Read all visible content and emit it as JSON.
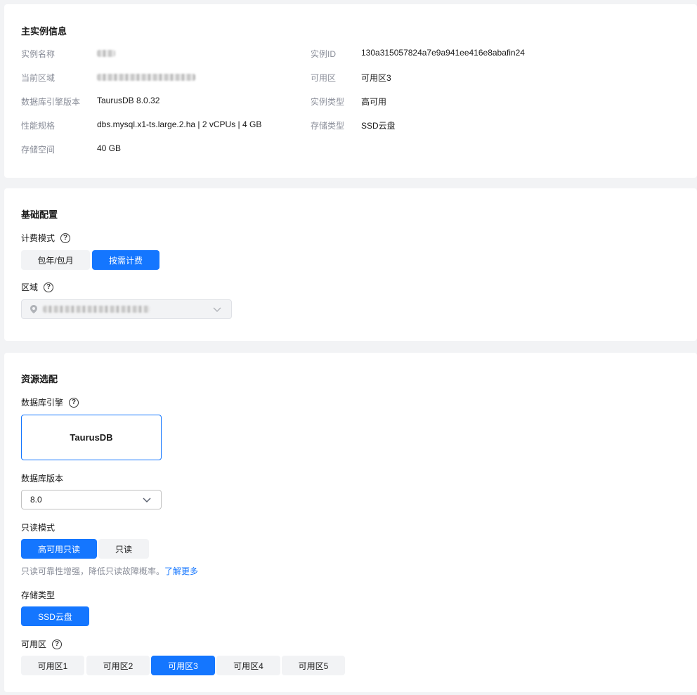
{
  "primary": {
    "title": "主实例信息",
    "rows": [
      {
        "label": "实例名称",
        "value": ""
      },
      {
        "label": "当前区域",
        "value": ""
      },
      {
        "label": "数据库引擎版本",
        "value": "TaurusDB 8.0.32"
      },
      {
        "label": "性能规格",
        "value": "dbs.mysql.x1-ts.large.2.ha | 2 vCPUs | 4 GB"
      },
      {
        "label": "存储空间",
        "value": "40 GB"
      }
    ],
    "rows_right": [
      {
        "label": "实例ID",
        "value": "130a315057824a7e9a941ee416e8abafin24"
      },
      {
        "label": "可用区",
        "value": "可用区3"
      },
      {
        "label": "实例类型",
        "value": "高可用"
      },
      {
        "label": "存储类型",
        "value": "SSD云盘"
      }
    ]
  },
  "basic": {
    "title": "基础配置",
    "billing_label": "计费模式",
    "billing_options": [
      "包年/包月",
      "按需计费"
    ],
    "billing_selected": "按需计费",
    "region_label": "区域"
  },
  "resource": {
    "title": "资源选配",
    "engine_label": "数据库引擎",
    "engine_value": "TaurusDB",
    "version_label": "数据库版本",
    "version_value": "8.0",
    "readonly_label": "只读模式",
    "readonly_options": [
      "高可用只读",
      "只读"
    ],
    "readonly_selected": "高可用只读",
    "readonly_hint": "只读可靠性增强，降低只读故障概率。",
    "readonly_link": "了解更多",
    "storage_label": "存储类型",
    "storage_option": "SSD云盘",
    "az_label": "可用区",
    "az_options": [
      "可用区1",
      "可用区2",
      "可用区3",
      "可用区4",
      "可用区5"
    ],
    "az_selected": "可用区3"
  },
  "icons": {
    "help": "help-circle-icon",
    "location": "location-pin-icon",
    "chevron": "chevron-down-icon"
  },
  "colors": {
    "accent": "#1476ff",
    "label": "#8a8e99",
    "segment_bg": "#f2f3f5"
  }
}
